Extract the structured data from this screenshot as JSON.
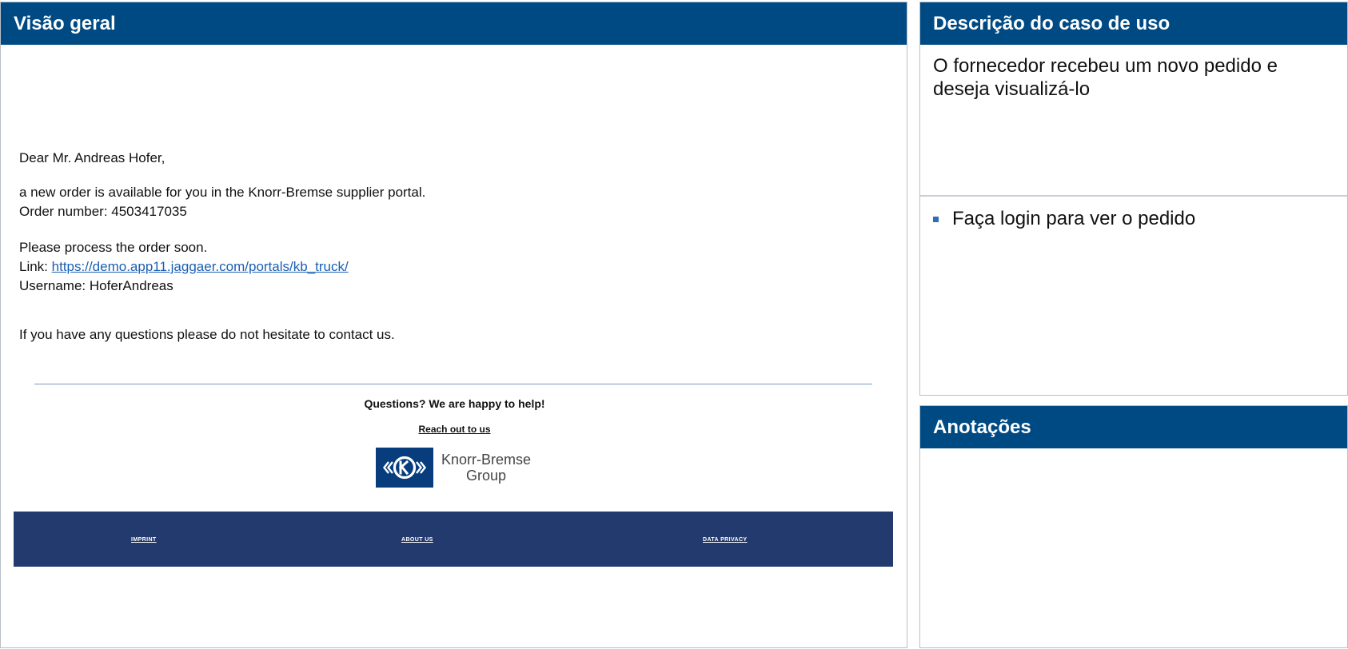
{
  "overview": {
    "title": "Visão geral",
    "email": {
      "greeting": "Dear Mr. Andreas Hofer,",
      "line1": "a new order is available for you in the Knorr-Bremse supplier portal.",
      "order_number": "Order number: 4503417035",
      "process": "Please process the order soon.",
      "link_label": "Link: ",
      "link_url": "https://demo.app11.jaggaer.com/portals/kb_truck/",
      "username": "Username: HoferAndreas",
      "questions": "If you have any questions please do not hesitate to contact us."
    },
    "footer": {
      "help_title": "Questions? We are happy to help!",
      "reach_out": "Reach out to us",
      "logo_line1": "Knorr-Bremse",
      "logo_line2": "Group",
      "links": [
        "IMPRINT",
        "ABOUT US",
        "DATA PRIVACY"
      ],
      "colors": {
        "bar": "#233a6e",
        "logo": "#073d7c"
      }
    }
  },
  "usecase": {
    "title": "Descrição do caso de uso",
    "description": "O fornecedor recebeu um novo pedido e deseja visualizá-lo",
    "steps": [
      "Faça login para ver o pedido"
    ]
  },
  "notes": {
    "title": "Anotações"
  },
  "theme": {
    "header_bg": "#004a84",
    "bullet": "#2f6db5",
    "link": "#1a5fb4"
  }
}
